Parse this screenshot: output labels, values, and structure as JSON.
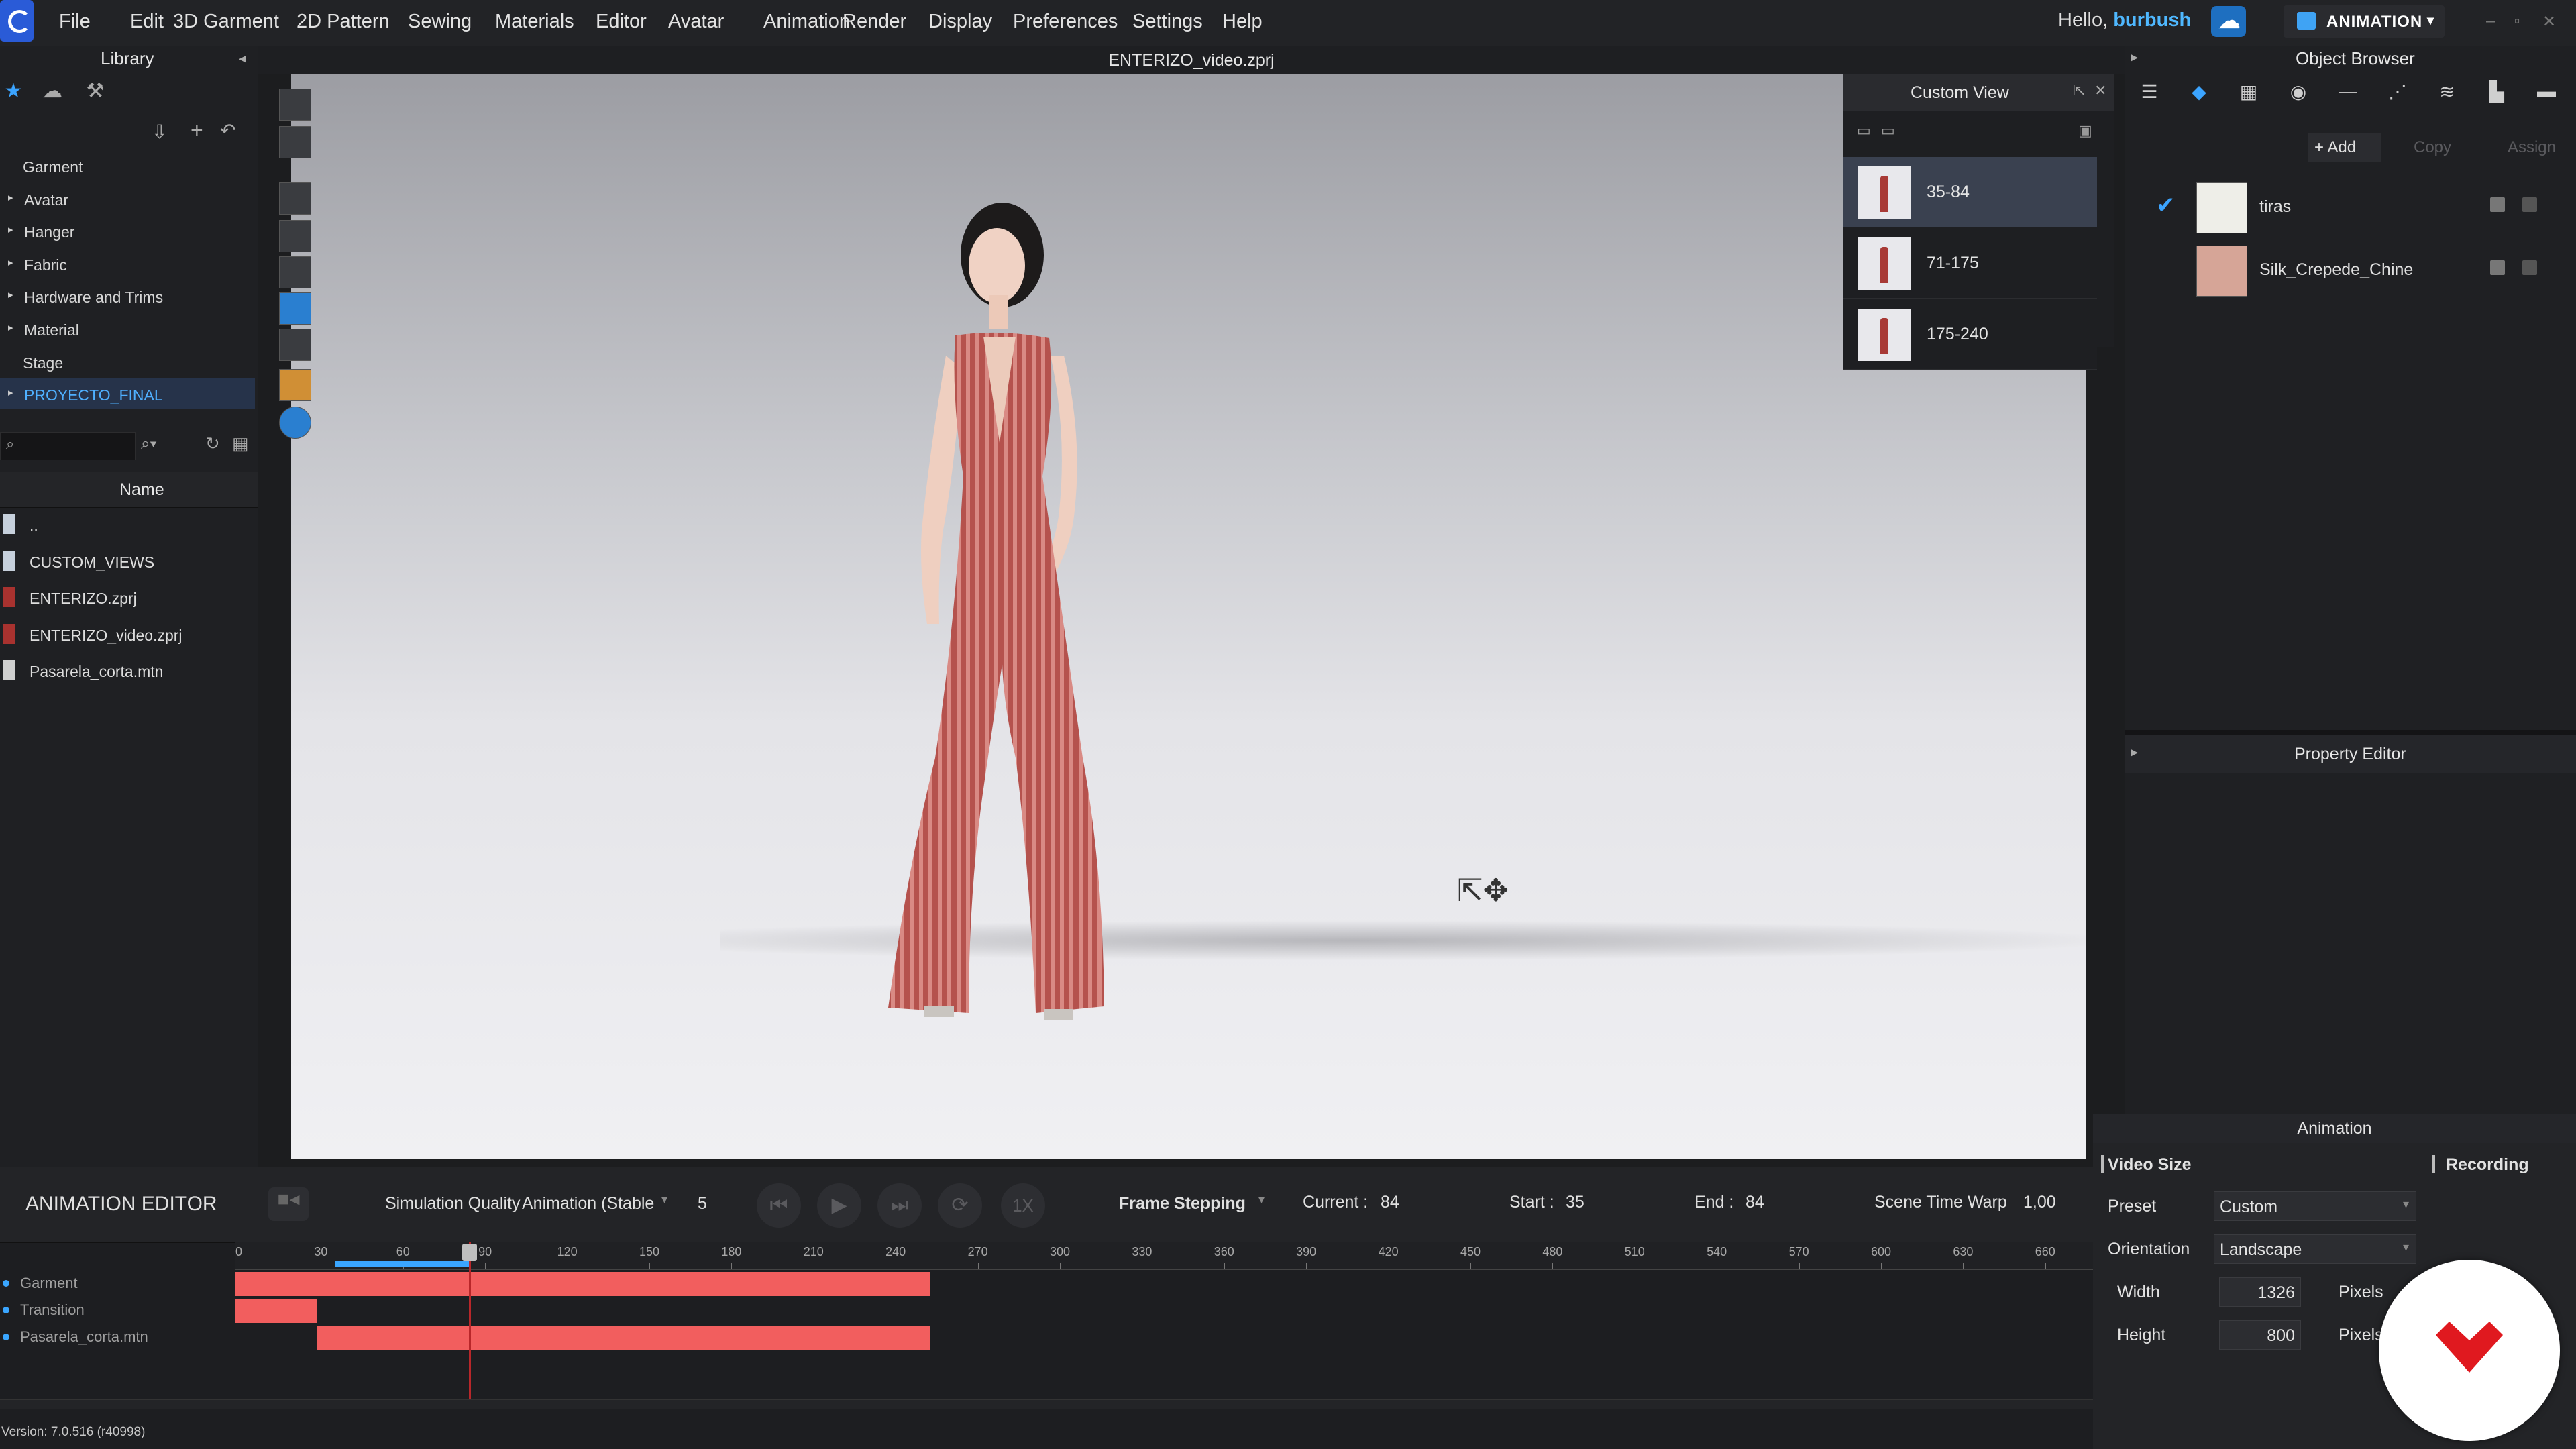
{
  "menu": {
    "items": [
      "File",
      "Edit",
      "3D Garment",
      "2D Pattern",
      "Sewing",
      "Materials",
      "Editor",
      "Avatar",
      "Animation",
      "Render",
      "Display",
      "Preferences",
      "Settings",
      "Help"
    ],
    "greeting": "Hello,",
    "user": "burbush",
    "mode": "ANIMATION"
  },
  "library": {
    "title": "Library",
    "categories": [
      {
        "label": "Garment",
        "expandable": false
      },
      {
        "label": "Avatar",
        "expandable": true
      },
      {
        "label": "Hanger",
        "expandable": true
      },
      {
        "label": "Fabric",
        "expandable": true
      },
      {
        "label": "Hardware and Trims",
        "expandable": true
      },
      {
        "label": "Material",
        "expandable": true
      },
      {
        "label": "Stage",
        "expandable": false
      },
      {
        "label": "PROYECTO_FINAL",
        "expandable": true,
        "selected": true
      }
    ],
    "name_header": "Name",
    "files": [
      {
        "label": "..",
        "icon": "folder-icon"
      },
      {
        "label": "CUSTOM_VIEWS",
        "icon": "folder-icon"
      },
      {
        "label": "ENTERIZO.zprj",
        "icon": "garment-file-icon"
      },
      {
        "label": "ENTERIZO_video.zprj",
        "icon": "garment-file-icon"
      },
      {
        "label": "Pasarela_corta.mtn",
        "icon": "motion-file-icon"
      }
    ]
  },
  "viewport": {
    "title": "ENTERIZO_video.zprj"
  },
  "custom_view": {
    "title": "Custom View",
    "items": [
      {
        "label": "35-84",
        "selected": true
      },
      {
        "label": "71-175",
        "selected": false
      },
      {
        "label": "175-240",
        "selected": false
      }
    ]
  },
  "object_browser": {
    "title": "Object Browser",
    "add_label": "+ Add",
    "copy_label": "Copy",
    "assign_label": "Assign",
    "materials": [
      {
        "name": "tiras",
        "color": "#eeeee8",
        "checked": true
      },
      {
        "name": "Silk_Crepede_Chine",
        "color": "#d6a597",
        "checked": false
      }
    ]
  },
  "property_editor": {
    "title": "Property Editor"
  },
  "animation_panel": {
    "title": "Animation",
    "video_size": "Video Size",
    "recording": "Recording",
    "preset_label": "Preset",
    "preset_value": "Custom",
    "orientation_label": "Orientation",
    "orientation_value": "Landscape",
    "width_label": "Width",
    "width_value": "1326",
    "height_label": "Height",
    "height_value": "800",
    "unit": "Pixels"
  },
  "animation_editor": {
    "title": "ANIMATION EDITOR",
    "quality_label": "Simulation Quality",
    "quality_value": "Animation (Stable",
    "steps": "5",
    "speed": "1X",
    "frame_mode": "Frame Stepping",
    "current_label": "Current :",
    "current_value": "84",
    "start_label": "Start :",
    "start_value": "35",
    "end_label": "End :",
    "end_value": "84",
    "warp_label": "Scene Time Warp",
    "warp_value": "1,00",
    "ruler": [
      "0",
      "30",
      "60",
      "90",
      "120",
      "150",
      "180",
      "210",
      "240",
      "270",
      "300",
      "330",
      "360",
      "390",
      "420",
      "450",
      "480",
      "510",
      "540",
      "570",
      "600",
      "630",
      "660"
    ],
    "tracks": [
      {
        "label": "Garment",
        "start": 0,
        "end": 254
      },
      {
        "label": "Transition",
        "start": 0,
        "end": 30
      },
      {
        "label": "Pasarela_corta.mtn",
        "start": 30,
        "end": 254
      }
    ],
    "current_frame": 84,
    "range_start": 35,
    "range_end": 84
  },
  "version": "Version: 7.0.516 (r40998)"
}
